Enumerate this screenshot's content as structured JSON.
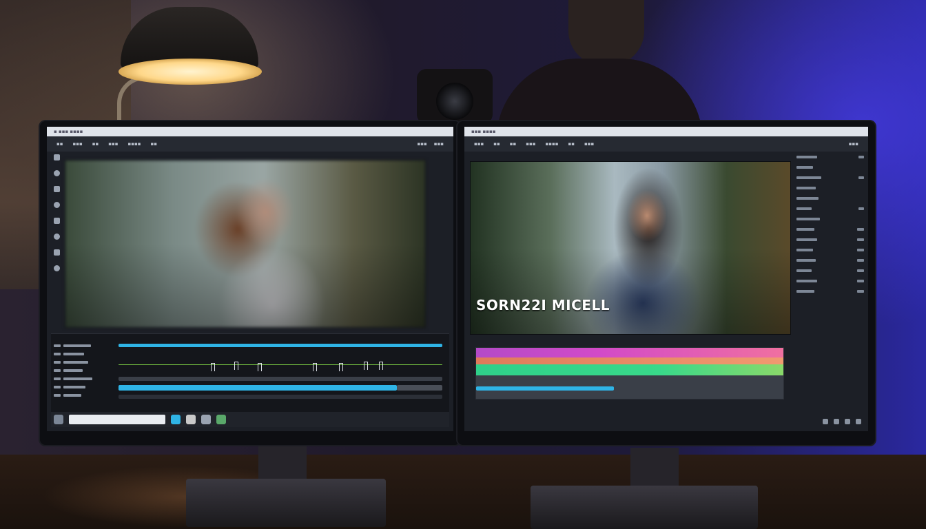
{
  "viewer_right": {
    "overlay_title": "SORN22I MICELL"
  },
  "colors": {
    "timeline_cyan": "#2fb4e6",
    "grade_magenta": "#d24ac8",
    "grade_green": "#39d98a",
    "grade_pink": "#f070a0",
    "ui_dark": "#1c1f26"
  },
  "icons": [
    "lamp",
    "camera",
    "search-icon",
    "folder-icon",
    "play-icon"
  ]
}
